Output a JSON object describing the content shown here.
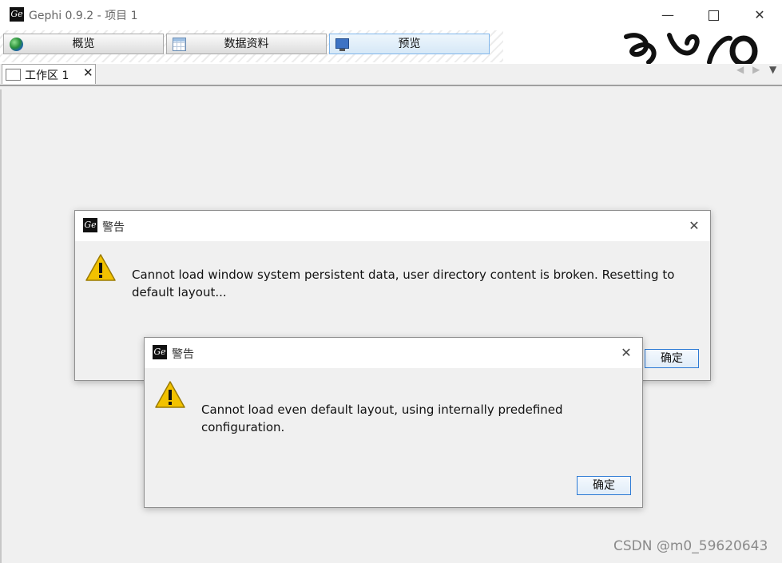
{
  "window": {
    "title": "Gephi 0.9.2 - 项目 1",
    "app_icon_glyph": "Ge",
    "minimize_glyph": "—",
    "close_glyph": "✕"
  },
  "toolbar": {
    "buttons": [
      {
        "label": "概览",
        "icon": "globe-icon"
      },
      {
        "label": "数据资料",
        "icon": "table-icon"
      },
      {
        "label": "预览",
        "icon": "monitor-icon",
        "active": true
      }
    ]
  },
  "tabs": [
    {
      "label": "工作区 1",
      "close_glyph": "✕"
    }
  ],
  "tab_nav": {
    "left": "◀",
    "right": "▶",
    "menu": "▼"
  },
  "dialogs": [
    {
      "title": "警告",
      "message": "Cannot load window system persistent data, user directory content is broken. Resetting to default layout...",
      "ok_label": "确定",
      "close_glyph": "✕"
    },
    {
      "title": "警告",
      "message": "Cannot load even default layout, using internally predefined configuration.",
      "ok_label": "确定",
      "close_glyph": "✕"
    }
  ],
  "watermark": "CSDN @m0_59620643",
  "colors": {
    "accent": "#2d7ad4",
    "warning": "#f2c200"
  }
}
